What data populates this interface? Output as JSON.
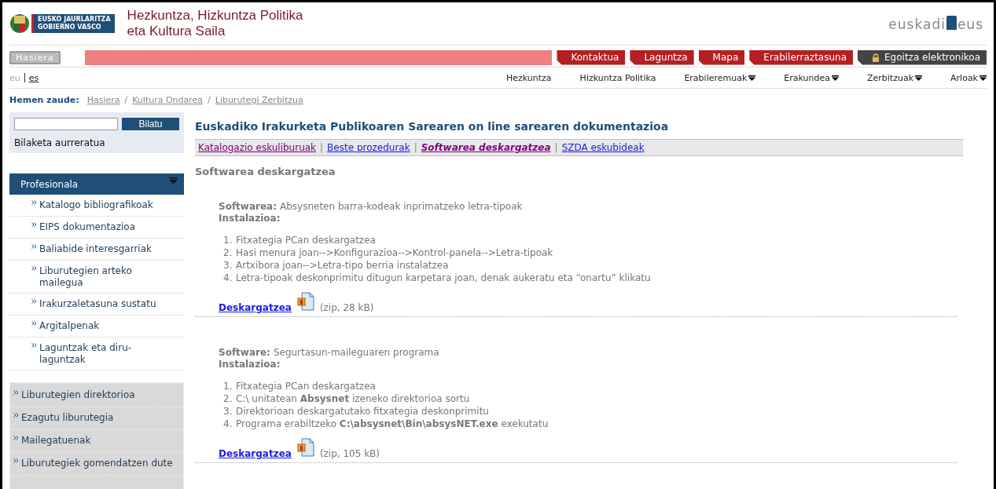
{
  "header": {
    "logo_lines": [
      "EUSKO JAURLARITZA",
      "GOBIERNO VASCO"
    ],
    "title_lines": [
      "Hezkuntza, Hizkuntza Politika",
      "eta Kultura Saila"
    ],
    "portal_logo": {
      "left": "euskadi",
      "right": "eus"
    }
  },
  "home_button": "Hasiera",
  "top_links": [
    {
      "label": "Kontaktua",
      "kind": "red"
    },
    {
      "label": "Laguntza",
      "kind": "red"
    },
    {
      "label": "Mapa",
      "kind": "red"
    },
    {
      "label": "Erabilerraztasuna",
      "kind": "red"
    },
    {
      "label": "Egoitza elektronikoa",
      "kind": "secure"
    }
  ],
  "languages": [
    {
      "label": "eu",
      "selected": true
    },
    {
      "label": "es",
      "selected": false
    }
  ],
  "nav": [
    {
      "label": "Hezkuntza",
      "dropdown": false
    },
    {
      "label": "Hizkuntza Politika",
      "dropdown": false
    },
    {
      "label": "Erabileremuak",
      "dropdown": true
    },
    {
      "label": "Erakundea",
      "dropdown": true
    },
    {
      "label": "Zerbitzuak",
      "dropdown": true
    },
    {
      "label": "Arloak",
      "dropdown": true
    }
  ],
  "breadcrumb": {
    "label": "Hemen zaude:",
    "separator": "/",
    "items": [
      "Hasiera",
      "Kultura Ondarea",
      "Liburutegi Zerbitzua"
    ]
  },
  "tab_separator": "|",
  "search": {
    "button": "Bilatu",
    "advanced": "Bilaketa aurreratua"
  },
  "sidebar": {
    "section": {
      "label": "Profesionala",
      "expanded": true
    },
    "items": [
      "Katalogo bibliografikoak",
      "EIPS dokumentazioa",
      "Baliabide interesgarriak",
      "Liburutegien arteko mailegua",
      "Irakurzaletasuna sustatu",
      "Argitalpenak",
      "Laguntzak eta diru-laguntzak"
    ],
    "links": [
      "Liburutegien direktorioa",
      "Ezagutu liburutegia",
      "Mailegatuenak",
      "Liburutegiek gomendatzen dute"
    ]
  },
  "page_title": "Euskadiko Irakurketa Publikoaren Sarearen on line sarearen dokumentazioa",
  "tabs": [
    {
      "label": "Katalogazio eskuliburuak",
      "selected": false,
      "visited": true
    },
    {
      "label": "Beste prozedurak",
      "selected": false,
      "visited": false
    },
    {
      "label": "Softwarea deskargatzea",
      "selected": true,
      "visited": true
    },
    {
      "label": "SZDA eskubideak",
      "selected": false,
      "visited": false
    }
  ],
  "section_title": "Softwarea deskargatzea",
  "downloads": [
    {
      "software_label": "Softwarea:",
      "software": "Absysneten barra-kodeak inprimatzeko letra-tipoak",
      "install_label": "Instalazioa:",
      "steps": [
        {
          "number": "1.",
          "text": "Fitxategia PCan deskargatzea"
        },
        {
          "number": "2.",
          "text": "Hasi menura joan-->Konfigurazioa-->Kontrol-panela-->Letra-tipoak"
        },
        {
          "number": "3.",
          "text": "Artxibora joan-->Letra-tipo berria instalatzea"
        },
        {
          "number": "4.",
          "text": "Letra-tipoak deskonprimitu ditugun karpetara joan, denak aukeratu eta “onartu” klikatu"
        }
      ],
      "link": "Deskargatzea",
      "info": "(zip, 28 kB)"
    },
    {
      "software_label": "Software:",
      "software": "Segurtasun-maileguaren programa",
      "install_label": "Instalazioa:",
      "steps": [
        {
          "number": "1.",
          "text": "Fitxategia PCan deskargatzea"
        },
        {
          "number": "2.",
          "text": "C:\\ unitatean **Absysnet** izeneko direktorioa sortu"
        },
        {
          "number": "3.",
          "text": "Direktorioan deskargatutako fitxategia deskonprimitu"
        },
        {
          "number": "4.",
          "text": "Programa erabiltzeko **C:\\absysnet\\Bin\\absysNET.exe** exekutatu"
        }
      ],
      "link": "Deskargatzea",
      "info": "(zip, 105 kB)"
    }
  ]
}
